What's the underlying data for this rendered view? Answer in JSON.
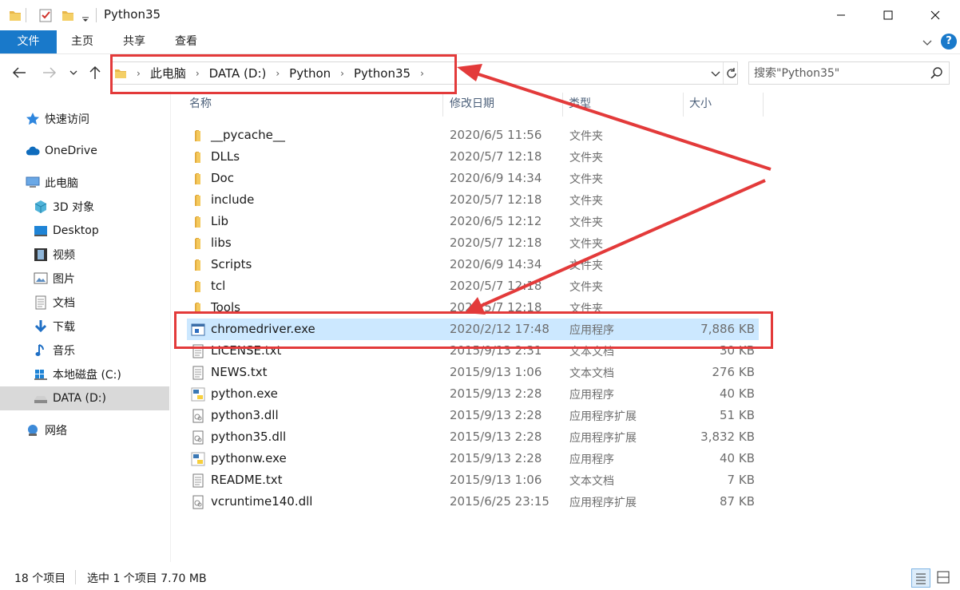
{
  "window": {
    "title": "Python35",
    "minimize_icon": "minimize-icon",
    "maximize_icon": "maximize-icon",
    "close_icon": "close-icon"
  },
  "ribbon": {
    "tabs": [
      "文件",
      "主页",
      "共享",
      "查看"
    ]
  },
  "address": {
    "crumbs": [
      "此电脑",
      "DATA (D:)",
      "Python",
      "Python35"
    ]
  },
  "search": {
    "placeholder": "搜索\"Python35\""
  },
  "sidebar": {
    "items": [
      {
        "label": "快速访问",
        "icon": "star-icon"
      },
      {
        "label": "OneDrive",
        "icon": "cloud-icon"
      },
      {
        "label": "此电脑",
        "icon": "computer-icon"
      },
      {
        "label": "3D 对象",
        "icon": "cube-icon"
      },
      {
        "label": "Desktop",
        "icon": "desktop-icon"
      },
      {
        "label": "视频",
        "icon": "film-icon"
      },
      {
        "label": "图片",
        "icon": "picture-icon"
      },
      {
        "label": "文档",
        "icon": "document-icon"
      },
      {
        "label": "下载",
        "icon": "download-icon"
      },
      {
        "label": "音乐",
        "icon": "music-icon"
      },
      {
        "label": "本地磁盘 (C:)",
        "icon": "windows-drive-icon"
      },
      {
        "label": "DATA (D:)",
        "icon": "drive-icon"
      },
      {
        "label": "网络",
        "icon": "network-icon"
      }
    ]
  },
  "columns": {
    "name": "名称",
    "date": "修改日期",
    "type": "类型",
    "size": "大小"
  },
  "files": [
    {
      "name": "__pycache__",
      "date": "2020/6/5 11:56",
      "type": "文件夹",
      "size": "",
      "icon": "folder-icon"
    },
    {
      "name": "DLLs",
      "date": "2020/5/7 12:18",
      "type": "文件夹",
      "size": "",
      "icon": "folder-icon"
    },
    {
      "name": "Doc",
      "date": "2020/6/9 14:34",
      "type": "文件夹",
      "size": "",
      "icon": "folder-icon"
    },
    {
      "name": "include",
      "date": "2020/5/7 12:18",
      "type": "文件夹",
      "size": "",
      "icon": "folder-icon"
    },
    {
      "name": "Lib",
      "date": "2020/6/5 12:12",
      "type": "文件夹",
      "size": "",
      "icon": "folder-icon"
    },
    {
      "name": "libs",
      "date": "2020/5/7 12:18",
      "type": "文件夹",
      "size": "",
      "icon": "folder-icon"
    },
    {
      "name": "Scripts",
      "date": "2020/6/9 14:34",
      "type": "文件夹",
      "size": "",
      "icon": "folder-icon"
    },
    {
      "name": "tcl",
      "date": "2020/5/7 12:18",
      "type": "文件夹",
      "size": "",
      "icon": "folder-icon"
    },
    {
      "name": "Tools",
      "date": "2020/5/7 12:18",
      "type": "文件夹",
      "size": "",
      "icon": "folder-icon"
    },
    {
      "name": "chromedriver.exe",
      "date": "2020/2/12 17:48",
      "type": "应用程序",
      "size": "7,886 KB",
      "icon": "exe-icon",
      "selected": true
    },
    {
      "name": "LICENSE.txt",
      "date": "2015/9/13 2:31",
      "type": "文本文档",
      "size": "30 KB",
      "icon": "text-file-icon"
    },
    {
      "name": "NEWS.txt",
      "date": "2015/9/13 1:06",
      "type": "文本文档",
      "size": "276 KB",
      "icon": "text-file-icon"
    },
    {
      "name": "python.exe",
      "date": "2015/9/13 2:28",
      "type": "应用程序",
      "size": "40 KB",
      "icon": "python-icon"
    },
    {
      "name": "python3.dll",
      "date": "2015/9/13 2:28",
      "type": "应用程序扩展",
      "size": "51 KB",
      "icon": "dll-icon"
    },
    {
      "name": "python35.dll",
      "date": "2015/9/13 2:28",
      "type": "应用程序扩展",
      "size": "3,832 KB",
      "icon": "dll-icon"
    },
    {
      "name": "pythonw.exe",
      "date": "2015/9/13 2:28",
      "type": "应用程序",
      "size": "40 KB",
      "icon": "python-icon"
    },
    {
      "name": "README.txt",
      "date": "2015/9/13 1:06",
      "type": "文本文档",
      "size": "7 KB",
      "icon": "text-file-icon"
    },
    {
      "name": "vcruntime140.dll",
      "date": "2015/6/25 23:15",
      "type": "应用程序扩展",
      "size": "87 KB",
      "icon": "dll-icon"
    }
  ],
  "status": {
    "count": "18 个项目",
    "selected": "选中 1 个项目  7.70 MB"
  },
  "colors": {
    "accent": "#1979ca",
    "selection": "#cce8ff",
    "annotation": "#e33a3a"
  }
}
